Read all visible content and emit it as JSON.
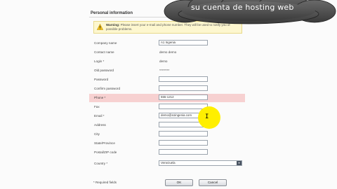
{
  "section_title": "Personal information",
  "warning": {
    "icon": "warning-icon",
    "title": "Warning:",
    "text": "Please insert your e-mail and phone number. They will be used to notify you of possible problems."
  },
  "fields": [
    {
      "label": "Company name",
      "value": "A1 Ingenia",
      "type": "input"
    },
    {
      "label": "Contact name",
      "value": "demo demo",
      "type": "text"
    },
    {
      "label": "Login *",
      "value": "demo",
      "type": "text"
    },
    {
      "label": "Old password",
      "value": "********",
      "type": "text"
    },
    {
      "label": "Password",
      "value": "",
      "type": "input"
    },
    {
      "label": "Confirm password",
      "value": "",
      "type": "input"
    },
    {
      "label": "Phone *",
      "value": "555-1212",
      "type": "input",
      "highlight": true
    },
    {
      "label": "Fax",
      "value": "",
      "type": "input"
    },
    {
      "label": "Email *",
      "value": "demo@a1ingenia.com",
      "type": "input"
    },
    {
      "label": "Address",
      "value": "",
      "type": "input"
    },
    {
      "label": "City",
      "value": "",
      "type": "input"
    },
    {
      "label": "State/Province",
      "value": "",
      "type": "input"
    },
    {
      "label": "Postal/ZIP code",
      "value": "",
      "type": "input"
    },
    {
      "label": "Country *",
      "value": "Venezuela",
      "type": "select"
    }
  ],
  "required_note": "* Required fields",
  "buttons": {
    "ok": "OK",
    "cancel": "Cancel"
  },
  "overlay": {
    "caption": "su cuenta de hosting web"
  }
}
